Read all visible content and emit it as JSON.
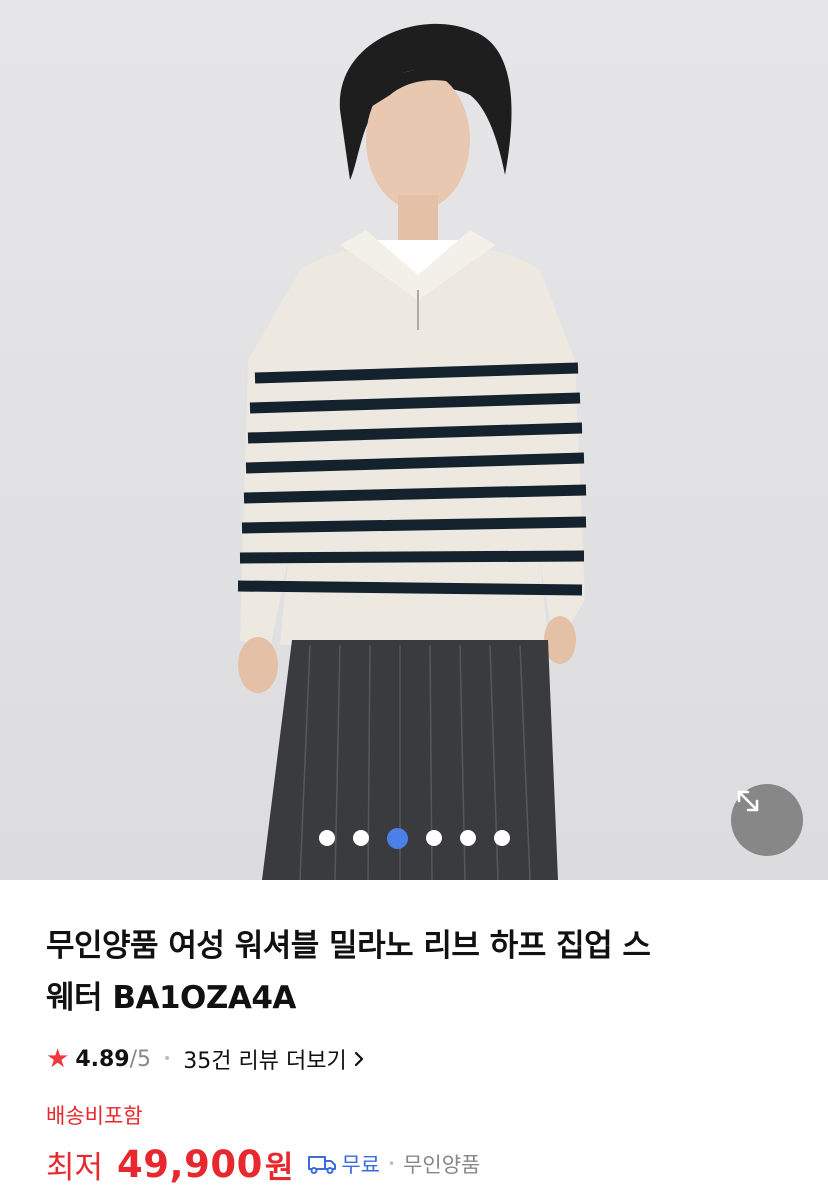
{
  "product": {
    "title_line1": "무인양품 여성 워셔블 밀라노 리브 하프 집업 스",
    "title_line2": "웨터 BA1OZA4A",
    "rating": {
      "score": "4.89",
      "out_of": "/5",
      "reviews_link": "35건 리뷰 더보기"
    },
    "shipping_note": "배송비포함",
    "price": {
      "prefix": "최저",
      "value": "49,900",
      "unit": "원"
    },
    "shipping_fee": "무료",
    "seller": "무인양품"
  },
  "gallery": {
    "total_images": 6,
    "active_index": 3
  },
  "colors": {
    "accent_red": "#e8282f",
    "star": "#f0383f",
    "shipping_blue": "#3b6be0",
    "active_dot": "#4d7fe9"
  },
  "icons": {
    "expand": "expand-arrows-icon",
    "star": "star-icon",
    "truck": "truck-icon",
    "chevron": "chevron-right-icon"
  }
}
